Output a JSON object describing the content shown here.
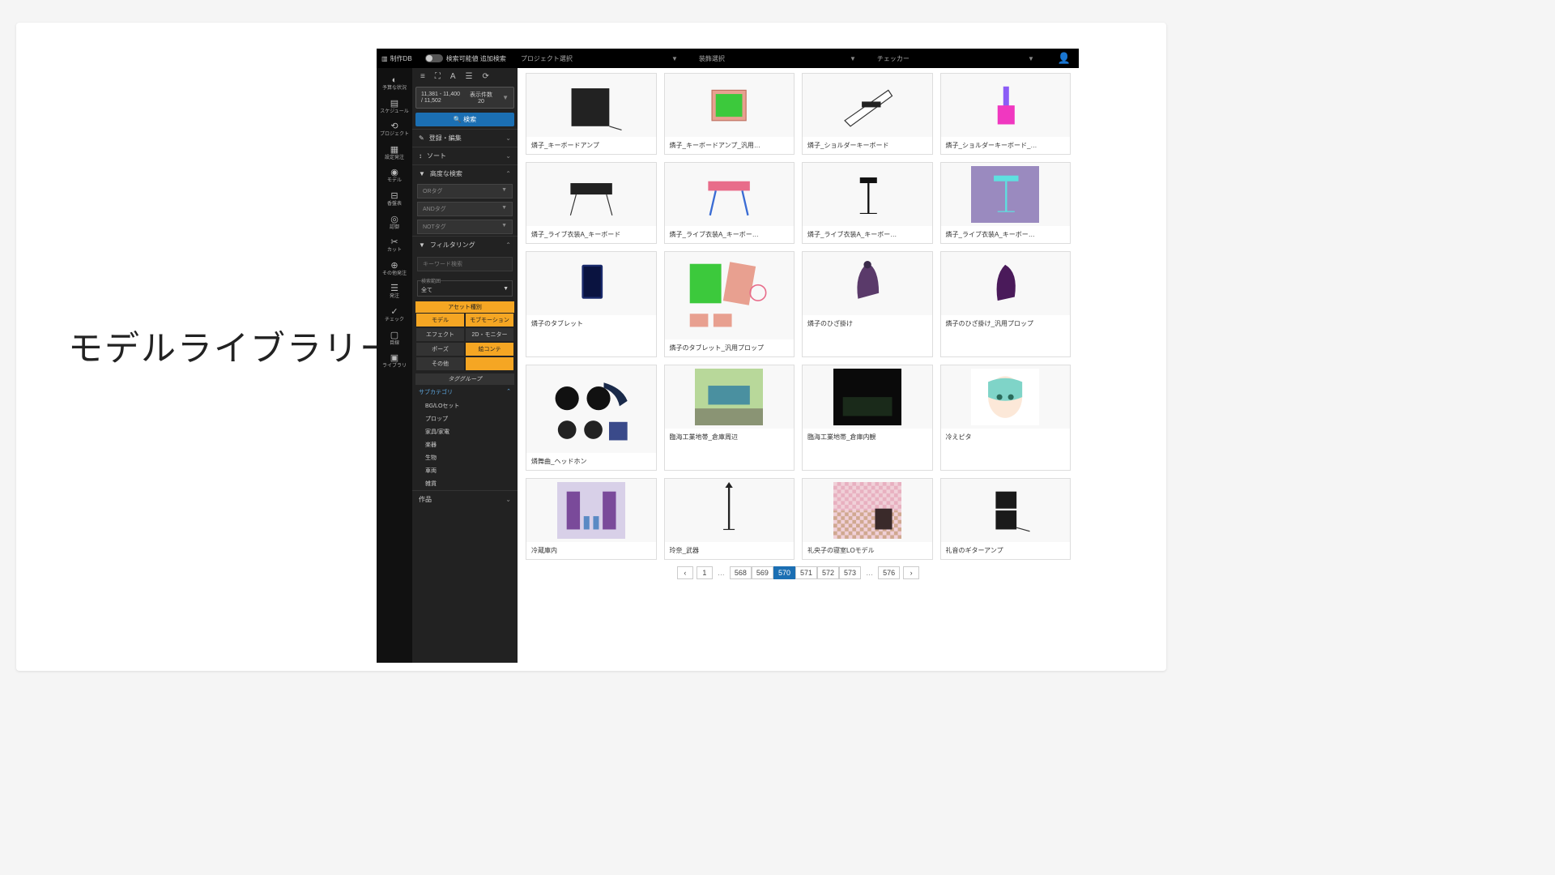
{
  "slide_title": "モデルライブラリー",
  "topbar": {
    "app_name": "制作DB",
    "toggle_labels": "検索可能値 追加検索",
    "selectors": [
      {
        "label": "プロジェクト選択"
      },
      {
        "label": "装飾選択"
      },
      {
        "label": "チェッカー"
      }
    ]
  },
  "leftnav": [
    {
      "icon": "◐",
      "label": "予算な状況"
    },
    {
      "icon": "▤",
      "label": "スケジュール"
    },
    {
      "icon": "⟲",
      "label": "プロジェクト"
    },
    {
      "icon": "▦",
      "label": "設定発注"
    },
    {
      "icon": "◉",
      "label": "モデル"
    },
    {
      "icon": "⊟",
      "label": "香盤表"
    },
    {
      "icon": "◎",
      "label": "認御"
    },
    {
      "icon": "✂",
      "label": "カット"
    },
    {
      "icon": "⊕",
      "label": "その他発注"
    },
    {
      "icon": "☰",
      "label": "発注"
    },
    {
      "icon": "✓",
      "label": "チェック"
    },
    {
      "icon": "▢",
      "label": "目線"
    },
    {
      "icon": "▣",
      "label": "ライブラリ"
    }
  ],
  "sidepanel": {
    "range": "11,381 - 11,400\n/ 11,502",
    "display_label": "表示件数",
    "display_value": "20",
    "search_btn": "検索",
    "sections": {
      "register": "登録・編集",
      "sort": "ソート",
      "advanced": "高度な検索",
      "filtering": "フィルタリング"
    },
    "tag_selects": [
      "ORタグ",
      "ANDタグ",
      "NOTタグ"
    ],
    "keyword_ph": "キーワード検索",
    "scope_label": "検索範囲",
    "scope_value": "全て",
    "asset_type_header": "アセット種別",
    "asset_types": [
      {
        "label": "モデル",
        "active": true
      },
      {
        "label": "モブモーション",
        "active": true
      },
      {
        "label": "エフェクト",
        "active": false
      },
      {
        "label": "2D・モニター",
        "active": false
      },
      {
        "label": "ポーズ",
        "active": false
      },
      {
        "label": "絵コンテ",
        "active": true
      },
      {
        "label": "その他",
        "active": false,
        "full": false
      },
      {
        "label": "",
        "active": true,
        "full": false
      }
    ],
    "tag_group_header": "タググループ",
    "subcategory": "サブカテゴリ",
    "sub_items": [
      "BG/LOセット",
      "プロップ",
      "家具/家電",
      "楽器",
      "生物",
      "車両",
      "雑貨"
    ],
    "works": "作品"
  },
  "assets": [
    {
      "name": "燐子_キーボードアンプ",
      "thumb": "amp"
    },
    {
      "name": "燐子_キーボードアンプ_汎用…",
      "thumb": "greenmon"
    },
    {
      "name": "燐子_ショルダーキーボード",
      "thumb": "keytar"
    },
    {
      "name": "燐子_ショルダーキーボード_…",
      "thumb": "keytar2"
    },
    {
      "name": "燐子_ライブ衣装A_キーボード",
      "thumb": "keysA"
    },
    {
      "name": "燐子_ライブ衣装A_キーボー…",
      "thumb": "keysB"
    },
    {
      "name": "燐子_ライブ衣装A_キーボー…",
      "thumb": "keystand"
    },
    {
      "name": "燐子_ライブ衣装A_キーボー…",
      "thumb": "keystand2"
    },
    {
      "name": "燐子のタブレット",
      "thumb": "tablet"
    },
    {
      "name": "燐子のタブレット_汎用プロップ",
      "thumb": "tabprops",
      "tall": true
    },
    {
      "name": "燐子のひざ掛け",
      "thumb": "blanket"
    },
    {
      "name": "燐子のひざ掛け_汎用プロップ",
      "thumb": "blanket2"
    },
    {
      "name": "燐舞曲_ヘッドホン",
      "thumb": "headphones",
      "tall": true
    },
    {
      "name": "臨海工業地帯_倉庫周辺",
      "thumb": "warehouse"
    },
    {
      "name": "臨海工業地帯_倉庫内観",
      "thumb": "warehouse2"
    },
    {
      "name": "冷えピタ",
      "thumb": "face"
    },
    {
      "name": "冷蔵庫内",
      "thumb": "fridge"
    },
    {
      "name": "玲奈_武器",
      "thumb": "weapon"
    },
    {
      "name": "礼央子の寝室LOモデル",
      "thumb": "bedroom"
    },
    {
      "name": "礼音のギターアンプ",
      "thumb": "guitaramp"
    }
  ],
  "pager": {
    "first": "1",
    "pages": [
      "568",
      "569",
      "570",
      "571",
      "572",
      "573"
    ],
    "current": "570",
    "last": "576"
  }
}
